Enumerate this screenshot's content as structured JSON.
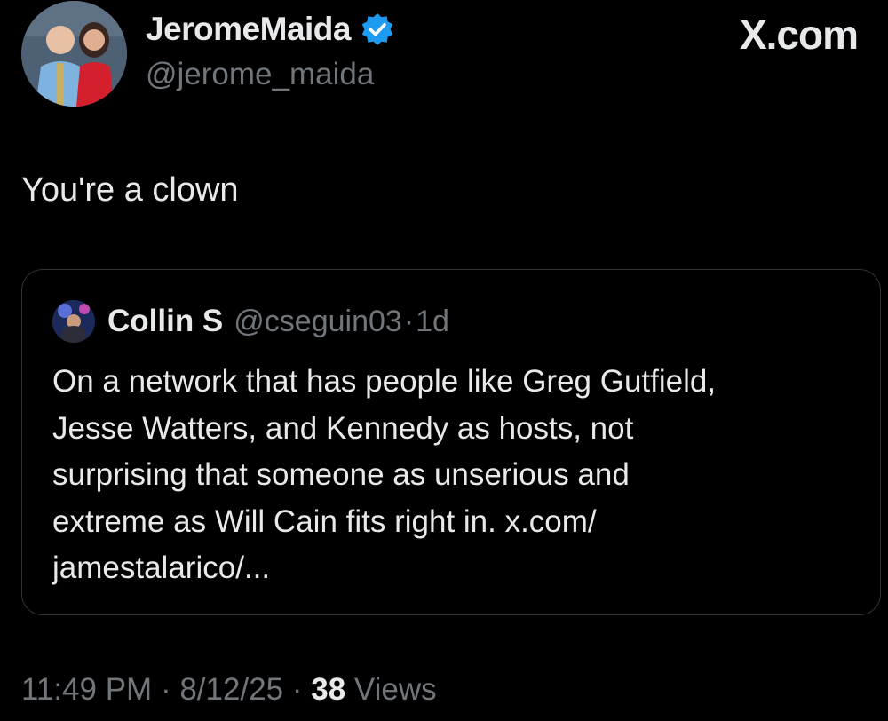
{
  "author": {
    "display_name": "JeromeMaida",
    "handle": "@jerome_maida",
    "avatar_icon": "profile-photo-icon",
    "verified_icon": "verified-badge-icon",
    "verified_color": "#1d9bf0"
  },
  "brand": {
    "label": "X.com"
  },
  "tweet": {
    "text": "You're a clown"
  },
  "quoted_tweet": {
    "display_name": "Collin S",
    "handle": "@cseguin03",
    "separator": "·",
    "age": "1d",
    "avatar_icon": "profile-photo-icon",
    "lines": [
      "On a network that has people like Greg Gutfield,",
      "Jesse Watters, and Kennedy as hosts, not",
      "surprising that someone as unserious and",
      "extreme as Will Cain fits right in. x.com/",
      "jamestalarico/..."
    ]
  },
  "footer": {
    "time": "11:49 PM",
    "separator": "·",
    "date": "8/12/25",
    "views_count": "38",
    "views_label": "Views"
  },
  "colors": {
    "background": "#000000",
    "primary_text": "#e7e9ea",
    "secondary_text": "#71767b",
    "border": "#2f3336"
  }
}
